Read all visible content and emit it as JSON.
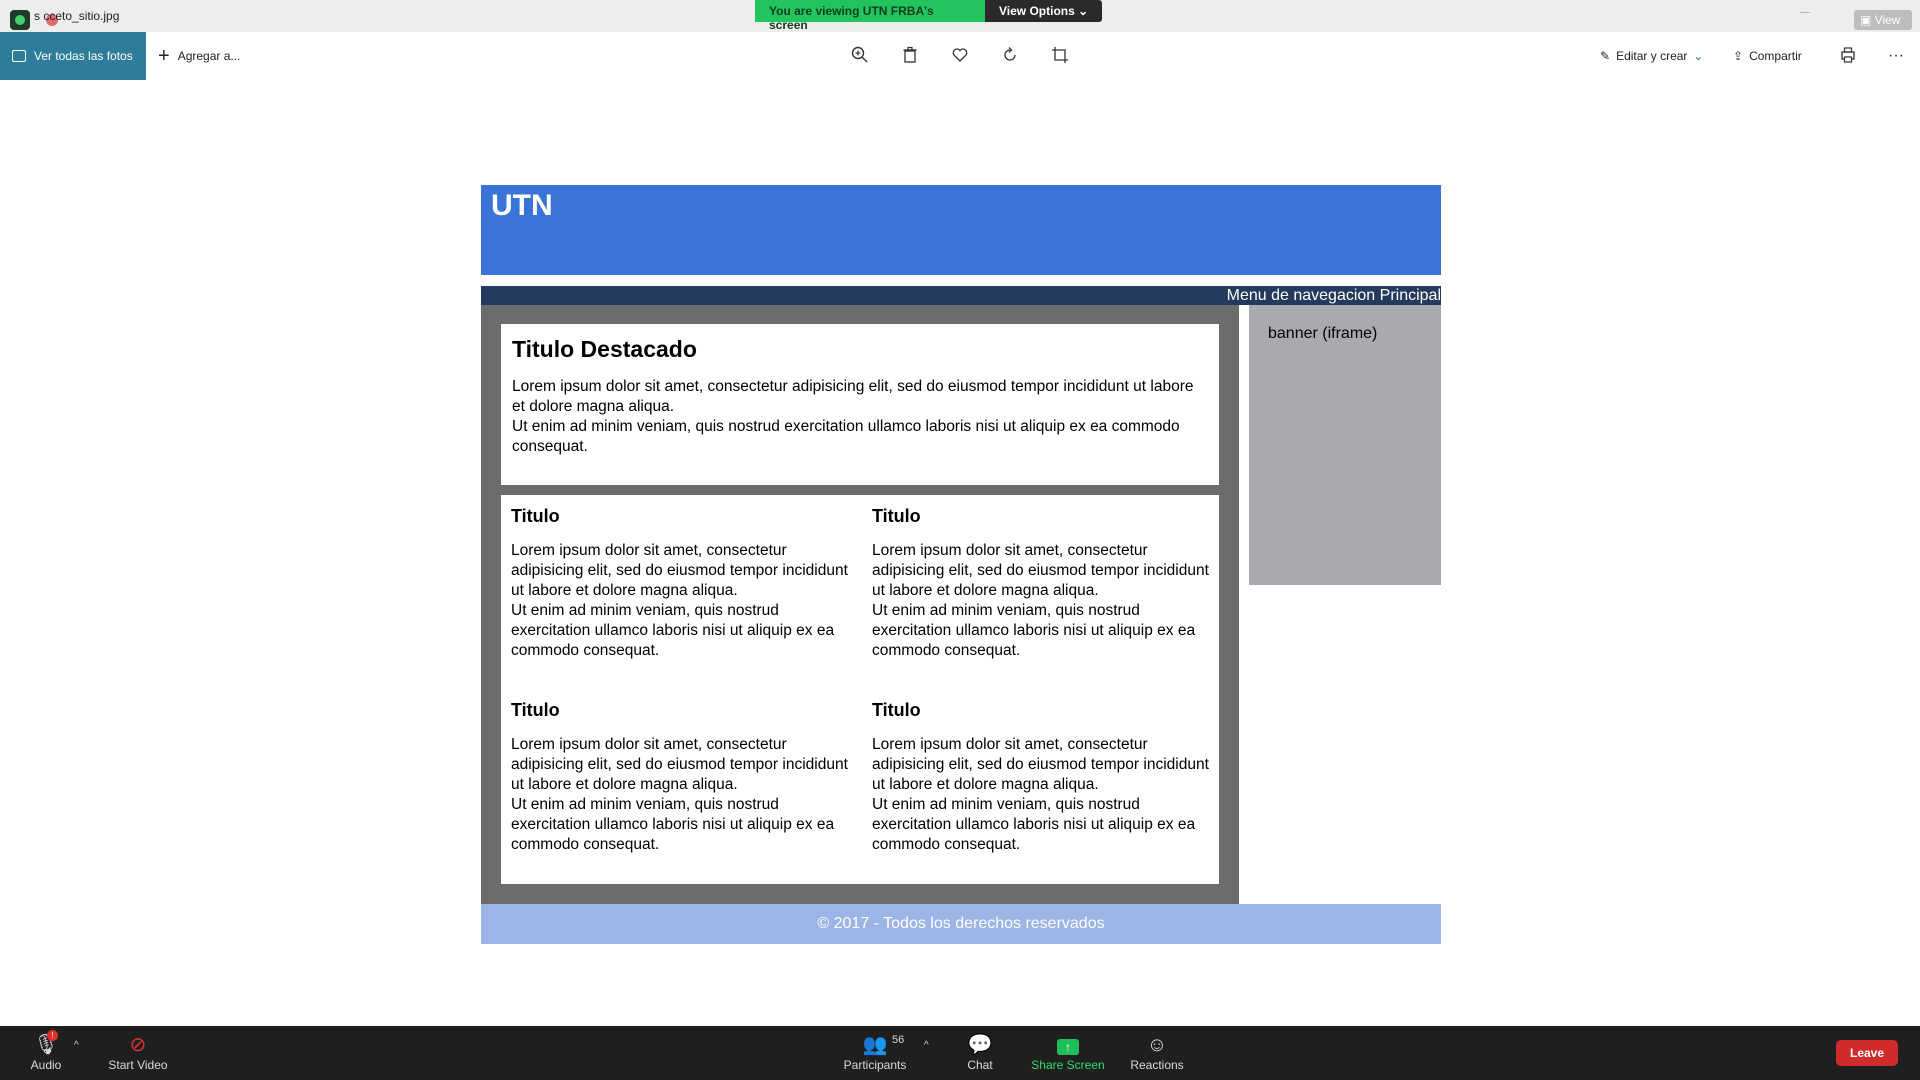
{
  "zoom_top": {
    "file_name": "s  cceto_sitio.jpg",
    "share_banner": "You are viewing UTN FRBA's screen",
    "view_options": "View Options ⌄",
    "view_button": "▣ View"
  },
  "photos_toolbar": {
    "all_photos": "Ver todas las fotos",
    "add": "Agregar a...",
    "edit_create": "Editar y crear",
    "share": "Compartir",
    "more": "···"
  },
  "site": {
    "header_title": "UTN",
    "nav_text": "Menu de navegacion Principal",
    "featured": {
      "title": "Titulo Destacado",
      "line1": "Lorem ipsum dolor sit amet, consectetur adipisicing elit, sed do eiusmod tempor incididunt ut labore et dolore magna aliqua.",
      "line2": "Ut enim ad minim veniam, quis nostrud exercitation ullamco laboris nisi ut aliquip ex ea commodo consequat."
    },
    "cards": [
      {
        "title": "Titulo",
        "line1": "Lorem ipsum dolor sit amet, consectetur adipisicing elit, sed do eiusmod tempor incididunt ut labore et dolore magna aliqua.",
        "line2": "Ut enim ad minim veniam, quis nostrud exercitation ullamco laboris nisi ut aliquip ex ea commodo consequat."
      },
      {
        "title": "Titulo",
        "line1": "Lorem ipsum dolor sit amet, consectetur adipisicing elit, sed do eiusmod tempor incididunt ut labore et dolore magna aliqua.",
        "line2": "Ut enim ad minim veniam, quis nostrud exercitation ullamco laboris nisi ut aliquip ex ea commodo consequat."
      },
      {
        "title": "Titulo",
        "line1": "Lorem ipsum dolor sit amet, consectetur adipisicing elit, sed do eiusmod tempor incididunt ut labore et dolore magna aliqua.",
        "line2": "Ut enim ad minim veniam, quis nostrud exercitation ullamco laboris nisi ut aliquip ex ea commodo consequat."
      },
      {
        "title": "Titulo",
        "line1": "Lorem ipsum dolor sit amet, consectetur adipisicing elit, sed do eiusmod tempor incididunt ut labore et dolore magna aliqua.",
        "line2": "Ut enim ad minim veniam, quis nostrud exercitation ullamco laboris nisi ut aliquip ex ea commodo consequat."
      }
    ],
    "banner": "banner (iframe)",
    "footer": "© 2017 - Todos los derechos reservados"
  },
  "zoom_bottom": {
    "audio": "Audio",
    "audio_badge": "!",
    "start_video": "Start Video",
    "participants": "Participants",
    "participants_count": "56",
    "chat": "Chat",
    "share_screen": "Share Screen",
    "reactions": "Reactions",
    "leave": "Leave"
  },
  "colors": {
    "header_blue": "#3b74d7",
    "nav_navy": "#243a5e",
    "content_gray": "#6c6c6c",
    "banner_gray": "#aaaaae",
    "footer_blue": "#9cb5e6",
    "photos_accent": "#2d7d9a",
    "zoom_green": "#21c45d",
    "leave_red": "#d02c2c"
  }
}
